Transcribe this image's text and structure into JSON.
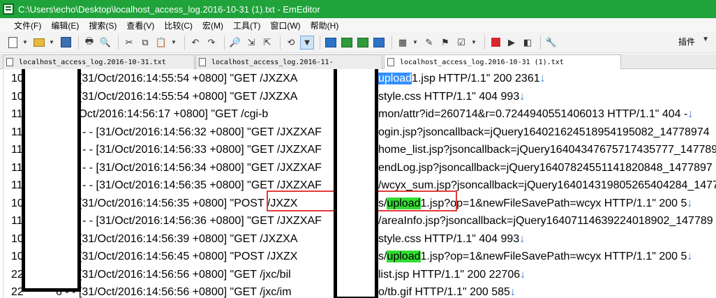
{
  "window": {
    "title": "C:\\Users\\echo\\Desktop\\localhost_access_log.2016-10-31 (1).txt - EmEditor"
  },
  "menu": [
    {
      "label": "文件(F)"
    },
    {
      "label": "编辑(E)"
    },
    {
      "label": "搜索(S)"
    },
    {
      "label": "查看(V)"
    },
    {
      "label": "比较(C)"
    },
    {
      "label": "宏(M)"
    },
    {
      "label": "工具(T)"
    },
    {
      "label": "窗口(W)"
    },
    {
      "label": "帮助(H)"
    }
  ],
  "toolbar": {
    "plugins_label": "插件"
  },
  "tabs": [
    {
      "label": "localhost_access_log.2016-10-31.txt",
      "active": false
    },
    {
      "label": "localhost_access_log.2016-11-",
      "active": false
    },
    {
      "label": "localhost_access_log.2016-10-31 (1).txt",
      "active": true
    }
  ],
  "lines": [
    {
      "a": "10",
      "b": "3 - - [31/Oct/2016:14:55:54 +0800] \"GET /JXZXA",
      "c": "",
      "hl": "upload",
      "hlType": "sel",
      "d": "1.jsp HTTP/1.1\" 200 2361",
      "nl": "↓"
    },
    {
      "a": "10",
      "b": "3 - - [31/Oct/2016:14:55:54 +0800] \"GET /JXZXA",
      "c": "style.css HTTP/1.1\" 404 993",
      "hl": "",
      "hlType": "",
      "d": "",
      "nl": "↓"
    },
    {
      "a": "11",
      "b": "02 - - [31/Oct/2016:14:56:17 +0800] \"GET /cgi-b",
      "c": "mon/attr?id=260714&r=0.7244940551406013 HTTP/1.1\" 404 -",
      "hl": "",
      "hlType": "",
      "d": "",
      "nl": "↓"
    },
    {
      "a": "11",
      "b": "- - [31/Oct/2016:14:56:32 +0800] \"GET /JXZXAF",
      "c": "ogin.jsp?jsoncallback=jQuery164021624518954195082_14778974",
      "hl": "",
      "hlType": "",
      "d": "",
      "nl": ""
    },
    {
      "a": "11",
      "b": "- - [31/Oct/2016:14:56:33 +0800] \"GET /JXZXAF",
      "c": "home_list.jsp?jsoncallback=jQuery16404347675717435777_147789",
      "hl": "",
      "hlType": "",
      "d": "",
      "nl": ""
    },
    {
      "a": "11",
      "b": "- - [31/Oct/2016:14:56:34 +0800] \"GET /JXZXAF",
      "c": "endLog.jsp?jsoncallback=jQuery1640782455114182084​8_1477897",
      "hl": "",
      "hlType": "",
      "d": "",
      "nl": ""
    },
    {
      "a": "11",
      "b": "- - [31/Oct/2016:14:56:35 +0800] \"GET /JXZXAF",
      "c": "/wcyx_sum.jsp?jsoncallback=jQuery16401431980526540428​4_1477",
      "hl": "",
      "hlType": "",
      "d": "",
      "nl": ""
    },
    {
      "a": "10",
      "b": "3 - - [31/Oct/2016:14:56:35 +0800] \"POST /JXZX",
      "c": "s/",
      "hl": "upload",
      "hlType": "find",
      "d": "1.jsp?op=1&newFileSavePath=wcyx HTTP/1.1\" 200 5",
      "nl": "↓"
    },
    {
      "a": "11",
      "b": "- - [31/Oct/2016:14:56:36 +0800] \"GET /JXZXAF",
      "c": "/areaInfo.jsp?jsoncallback=jQuery16407114639224018902_147789",
      "hl": "",
      "hlType": "",
      "d": "",
      "nl": ""
    },
    {
      "a": "10",
      "b": "3 - - [31/Oct/2016:14:56:39 +0800] \"GET /JXZXA",
      "c": "style.css HTTP/1.1\" 404 993",
      "hl": "",
      "hlType": "",
      "d": "",
      "nl": "↓"
    },
    {
      "a": "10",
      "b": "3 - - [31/Oct/2016:14:56:45 +0800] \"POST /JXZX",
      "c": "s/",
      "hl": "upload",
      "hlType": "find",
      "d": "1.jsp?op=1&newFileSavePath=wcyx HTTP/1.1\" 200 5",
      "nl": "↓"
    },
    {
      "a": "22",
      "b": "6 - - [31/Oct/2016:14:56:56 +0800] \"GET /jxc/bil",
      "c": "list.jsp HTTP/1.1\" 200 22706",
      "hl": "",
      "hlType": "",
      "d": "",
      "nl": "↓"
    },
    {
      "a": "22",
      "b": "6 - - [31/Oct/2016:14:56:56 +0800] \"GET /jxc/im",
      "c": "o/tb.gif HTTP/1.1\" 200 585",
      "hl": "",
      "hlType": "",
      "d": "",
      "nl": "↓"
    }
  ]
}
